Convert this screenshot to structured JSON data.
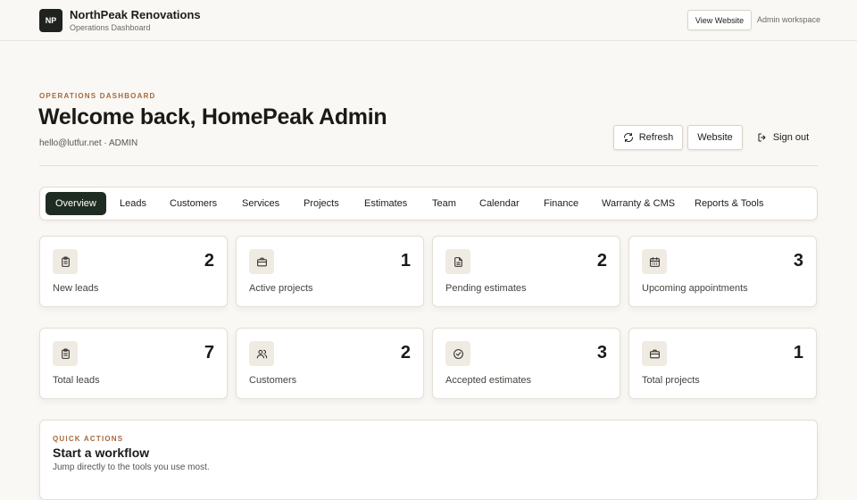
{
  "brand": {
    "logo_text": "NP",
    "name": "NorthPeak Renovations",
    "subtitle": "Operations Dashboard"
  },
  "topbar": {
    "view_website": "View Website",
    "workspace": "Admin workspace"
  },
  "header": {
    "eyebrow": "OPERATIONS DASHBOARD",
    "title": "Welcome back, HomePeak Admin",
    "user_line": "hello@lutfur.net · ADMIN",
    "refresh": "Refresh",
    "website": "Website",
    "sign_out": "Sign out"
  },
  "tabs": [
    {
      "label": "Overview",
      "active": true
    },
    {
      "label": "Leads"
    },
    {
      "label": "Customers"
    },
    {
      "label": "Services"
    },
    {
      "label": "Projects"
    },
    {
      "label": "Estimates"
    },
    {
      "label": "Team"
    },
    {
      "label": "Calendar"
    },
    {
      "label": "Finance"
    },
    {
      "label": "Warranty & CMS"
    },
    {
      "label": "Reports & Tools"
    }
  ],
  "stats": [
    {
      "icon": "clipboard-icon",
      "value": "2",
      "label": "New leads"
    },
    {
      "icon": "briefcase-icon",
      "value": "1",
      "label": "Active projects"
    },
    {
      "icon": "document-icon",
      "value": "2",
      "label": "Pending estimates"
    },
    {
      "icon": "calendar-icon",
      "value": "3",
      "label": "Upcoming appointments"
    },
    {
      "icon": "clipboard-icon",
      "value": "7",
      "label": "Total leads"
    },
    {
      "icon": "users-icon",
      "value": "2",
      "label": "Customers"
    },
    {
      "icon": "check-circle-icon",
      "value": "3",
      "label": "Accepted estimates"
    },
    {
      "icon": "briefcase-icon",
      "value": "1",
      "label": "Total projects"
    }
  ],
  "quick_actions": {
    "eyebrow": "QUICK ACTIONS",
    "title": "Start a workflow",
    "subtitle": "Jump directly to the tools you use most."
  },
  "colors": {
    "accent": "#a6693d",
    "active_tab": "#1f2c22",
    "background": "#faf8f4"
  }
}
